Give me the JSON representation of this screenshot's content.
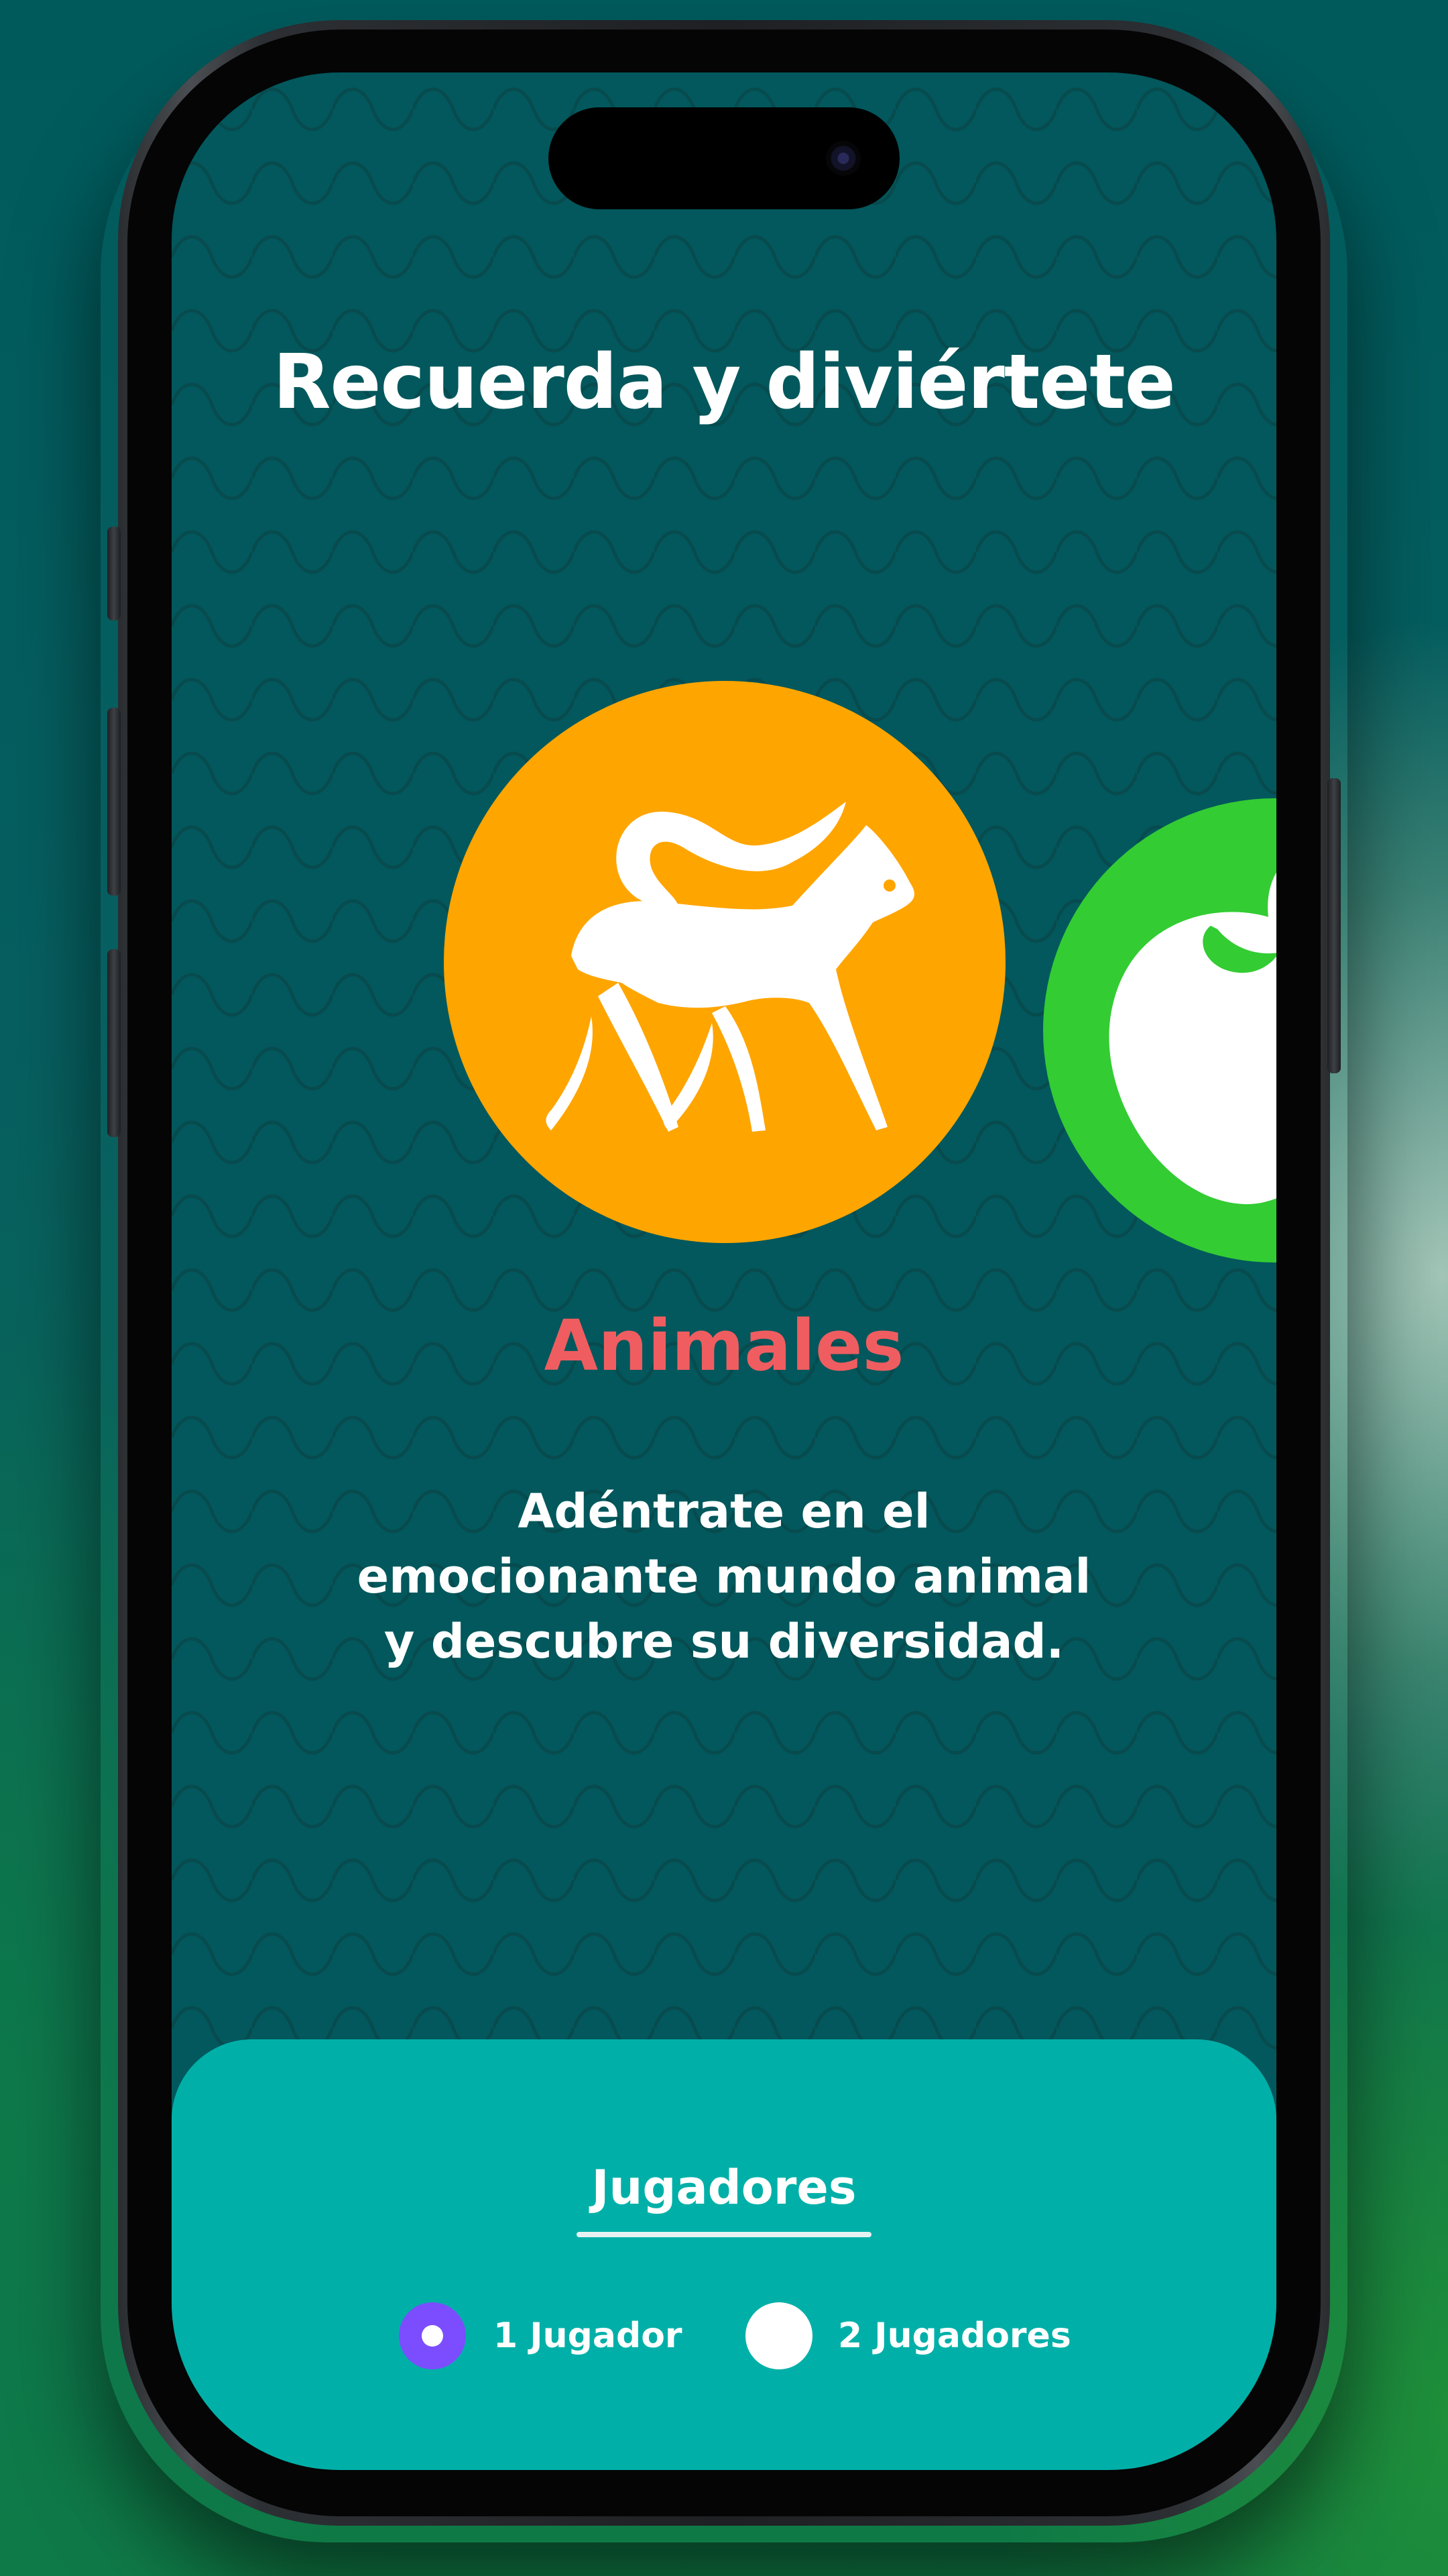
{
  "app": {
    "title": "Recuerda y diviértete"
  },
  "carousel": {
    "current": {
      "category": "Animales",
      "description": "Adéntrate en el emocionante mundo animal y descubre su diversidad.",
      "icon": "cat-icon",
      "color": "#ffa500",
      "title_color": "#ef5d60"
    },
    "next": {
      "icon": "apple-icon",
      "color": "#33cc33"
    }
  },
  "players": {
    "title": "Jugadores",
    "options": [
      {
        "label": "1 Jugador",
        "selected": true
      },
      {
        "label": "2 Jugadores",
        "selected": false
      }
    ]
  },
  "colors": {
    "background": "#02585c",
    "panel": "#00b0a8",
    "accent": "#7b4dff"
  }
}
